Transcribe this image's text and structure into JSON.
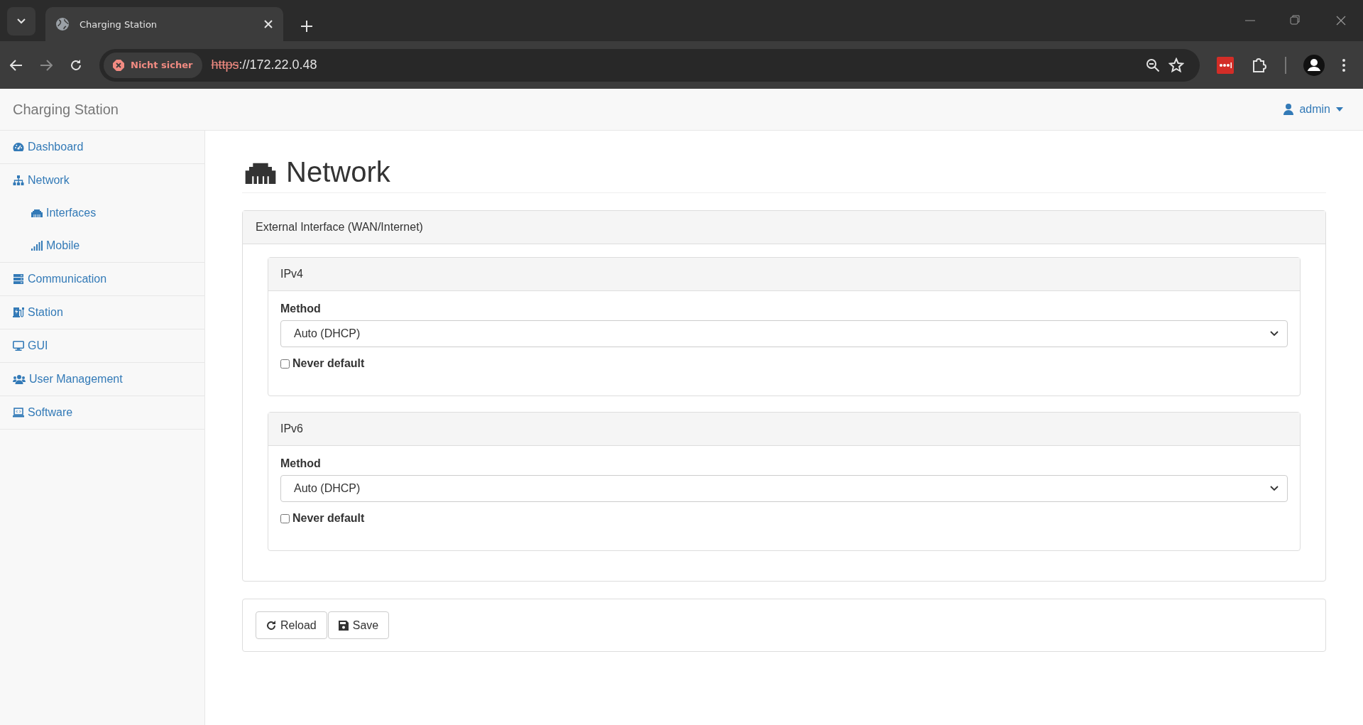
{
  "browser": {
    "tab_title": "Charging Station",
    "security_label": "Nicht sicher",
    "url_scheme": "https",
    "url_rest": "://172.22.0.48"
  },
  "navbar": {
    "brand": "Charging Station",
    "user": "admin"
  },
  "sidebar": {
    "items": [
      {
        "label": "Dashboard",
        "kind": "dashboard"
      },
      {
        "label": "Network",
        "kind": "network",
        "children": [
          {
            "label": "Interfaces",
            "kind": "ethernet"
          },
          {
            "label": "Mobile",
            "kind": "signal"
          }
        ]
      },
      {
        "label": "Communication",
        "kind": "server"
      },
      {
        "label": "Station",
        "kind": "station"
      },
      {
        "label": "GUI",
        "kind": "monitor"
      },
      {
        "label": "User Management",
        "kind": "users"
      },
      {
        "label": "Software",
        "kind": "laptop"
      }
    ]
  },
  "page": {
    "title": "Network",
    "panel": {
      "title": "External Interface (WAN/Internet)",
      "sections": [
        {
          "title": "IPv4",
          "method_label": "Method",
          "method_value": "Auto (DHCP)",
          "never_default": {
            "label": "Never default",
            "checked": false
          }
        },
        {
          "title": "IPv6",
          "method_label": "Method",
          "method_value": "Auto (DHCP)",
          "never_default": {
            "label": "Never default",
            "checked": false
          }
        }
      ]
    },
    "buttons": [
      {
        "label": "Reload",
        "kind": "reload"
      },
      {
        "label": "Save",
        "kind": "save"
      }
    ]
  }
}
